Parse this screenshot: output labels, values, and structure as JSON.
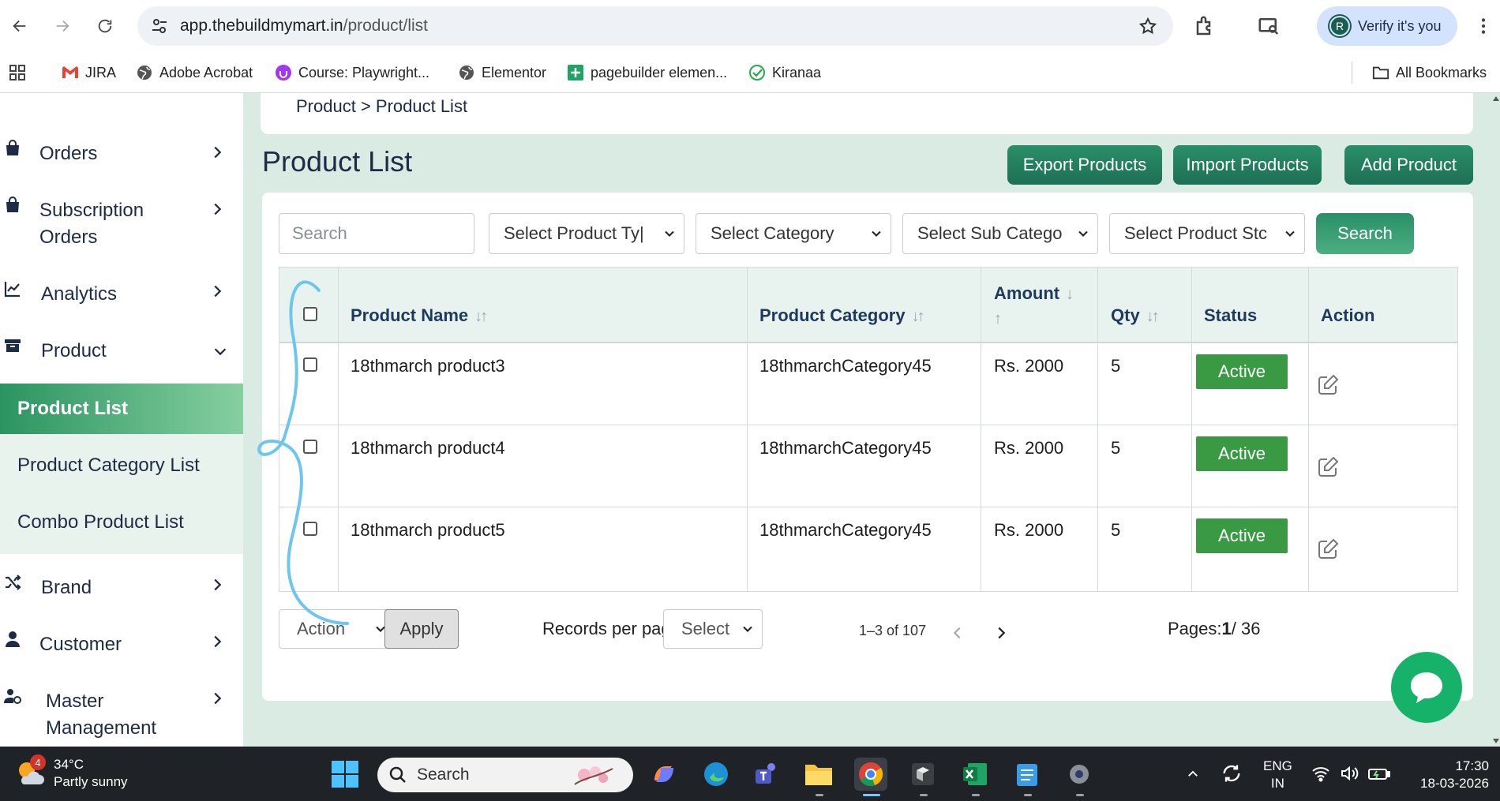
{
  "browser": {
    "url_host": "app.thebuildmymart.in",
    "url_path": "/product/list",
    "profile_initial": "R",
    "verify_label": "Verify it's you",
    "bookmarks": [
      {
        "label": "JIRA",
        "icon": "gmail-icon"
      },
      {
        "label": "Adobe Acrobat",
        "icon": "globe-icon"
      },
      {
        "label": "Course: Playwright...",
        "icon": "udemy-icon"
      },
      {
        "label": "Elementor",
        "icon": "globe-icon"
      },
      {
        "label": "pagebuilder elemen...",
        "icon": "sheets-icon"
      },
      {
        "label": "Kiranaa",
        "icon": "check-circle-icon"
      }
    ],
    "all_bookmarks_label": "All Bookmarks"
  },
  "sidebar": {
    "items": [
      {
        "label": "Orders",
        "icon": "bag-icon"
      },
      {
        "label": "Subscription Orders",
        "line1": "Subscription",
        "line2": "Orders",
        "icon": "bag-icon"
      },
      {
        "label": "Analytics",
        "icon": "chart-icon"
      },
      {
        "label": "Product",
        "icon": "box-icon"
      },
      {
        "label": "Brand",
        "icon": "shuffle-icon"
      },
      {
        "label": "Customer",
        "icon": "user-icon"
      },
      {
        "label": "Master Management",
        "line1": "Master",
        "line2": "Management",
        "icon": "user-gear-icon"
      }
    ],
    "submenu": [
      "Product List",
      "Product Category List",
      "Combo Product List"
    ]
  },
  "main": {
    "breadcrumb": "Product > Product List",
    "title": "Product List",
    "buttons": {
      "export": "Export Products",
      "import": "Import Products",
      "add": "Add Product"
    },
    "filters": {
      "search_placeholder": "Search",
      "product_type": "Select Product Ty|",
      "category": "Select Category",
      "sub_category": "Select Sub Catego",
      "product_status": "Select Product Stc",
      "search_button": "Search"
    },
    "table": {
      "columns": {
        "product_name": "Product Name",
        "product_category": "Product Category",
        "amount": "Amount",
        "qty": "Qty",
        "status": "Status",
        "action": "Action"
      },
      "rows": [
        {
          "name": "18thmarch product3",
          "category": "18thmarchCategory45",
          "amount": "Rs. 2000",
          "qty": "5",
          "status": "Active"
        },
        {
          "name": "18thmarch product4",
          "category": "18thmarchCategory45",
          "amount": "Rs. 2000",
          "qty": "5",
          "status": "Active"
        },
        {
          "name": "18thmarch product5",
          "category": "18thmarchCategory45",
          "amount": "Rs. 2000",
          "qty": "5",
          "status": "Active"
        }
      ]
    },
    "footer": {
      "bulk_action": "Action",
      "apply": "Apply",
      "records_label": "Records per page:",
      "records_select": "Select",
      "range": "1–3 of 107",
      "pages_prefix": "Pages:",
      "current_page": "1",
      "total_pages": "/ 36"
    }
  },
  "taskbar": {
    "weather_badge": "4",
    "temperature": "34°C",
    "condition": "Partly sunny",
    "search_placeholder": "Search",
    "lang_line1": "ENG",
    "lang_line2": "IN",
    "time": "17:30",
    "date": "18-03-2026"
  },
  "colors": {
    "accent_green": "#1d6f55",
    "active_badge": "#3a9a43",
    "main_bg": "#d9ebe3",
    "annotation_blue": "#6ec6ee"
  }
}
